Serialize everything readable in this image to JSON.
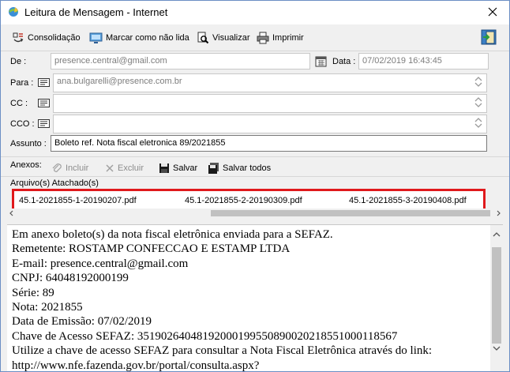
{
  "window": {
    "title": "Leitura de Mensagem - Internet"
  },
  "toolbar": {
    "consolidacao": "Consolidação",
    "marcar_nao_lida": "Marcar como não lida",
    "visualizar": "Visualizar",
    "imprimir": "Imprimir"
  },
  "form": {
    "de_label": "De :",
    "de_value": "presence.central@gmail.com",
    "data_label": "Data :",
    "data_value": "07/02/2019 16:43:45",
    "para_label": "Para :",
    "para_value": "ana.bulgarelli@presence.com.br",
    "cc_label": "CC :",
    "cc_value": "",
    "cco_label": "CCO :",
    "cco_value": "",
    "assunto_label": "Assunto :",
    "assunto_value": "Boleto ref. Nota fiscal eletronica 89/2021855"
  },
  "anexos": {
    "label": "Anexos:",
    "incluir": "Incluir",
    "excluir": "Excluir",
    "salvar": "Salvar",
    "salvar_todos": "Salvar todos",
    "attached_label": "Arquivo(s) Atachado(s)",
    "files": [
      "45.1-2021855-1-20190207.pdf",
      "45.1-2021855-2-20190309.pdf",
      "45.1-2021855-3-20190408.pdf"
    ]
  },
  "message": {
    "lines": [
      "Em anexo boleto(s) da nota fiscal eletrônica enviada para a SEFAZ.",
      "Remetente: ROSTAMP CONFECCAO E ESTAMP LTDA",
      "E-mail: presence.central@gmail.com",
      "CNPJ: 64048192000199",
      "Série: 89",
      "Nota: 2021855",
      "Data de Emissão: 07/02/2019",
      "Chave de Acesso SEFAZ: 35190264048192000199550890020218551000118567",
      "Utilize a chave de acesso SEFAZ para consultar a Nota Fiscal Eletrônica através do link:",
      "http://www.nfe.fazenda.gov.br/portal/consulta.aspx?"
    ]
  },
  "colors": {
    "highlight_border": "#e0191c",
    "accent": "#2e6fb8"
  },
  "icons": [
    "app-icon",
    "close-icon",
    "consolidacao-icon",
    "monitor-icon",
    "magnifier-icon",
    "printer-icon",
    "exit-door-icon",
    "calendar-icon",
    "address-book-icon",
    "spin-arrows-icon",
    "paperclip-icon",
    "x-icon",
    "floppy-icon",
    "floppy-stack-icon"
  ]
}
